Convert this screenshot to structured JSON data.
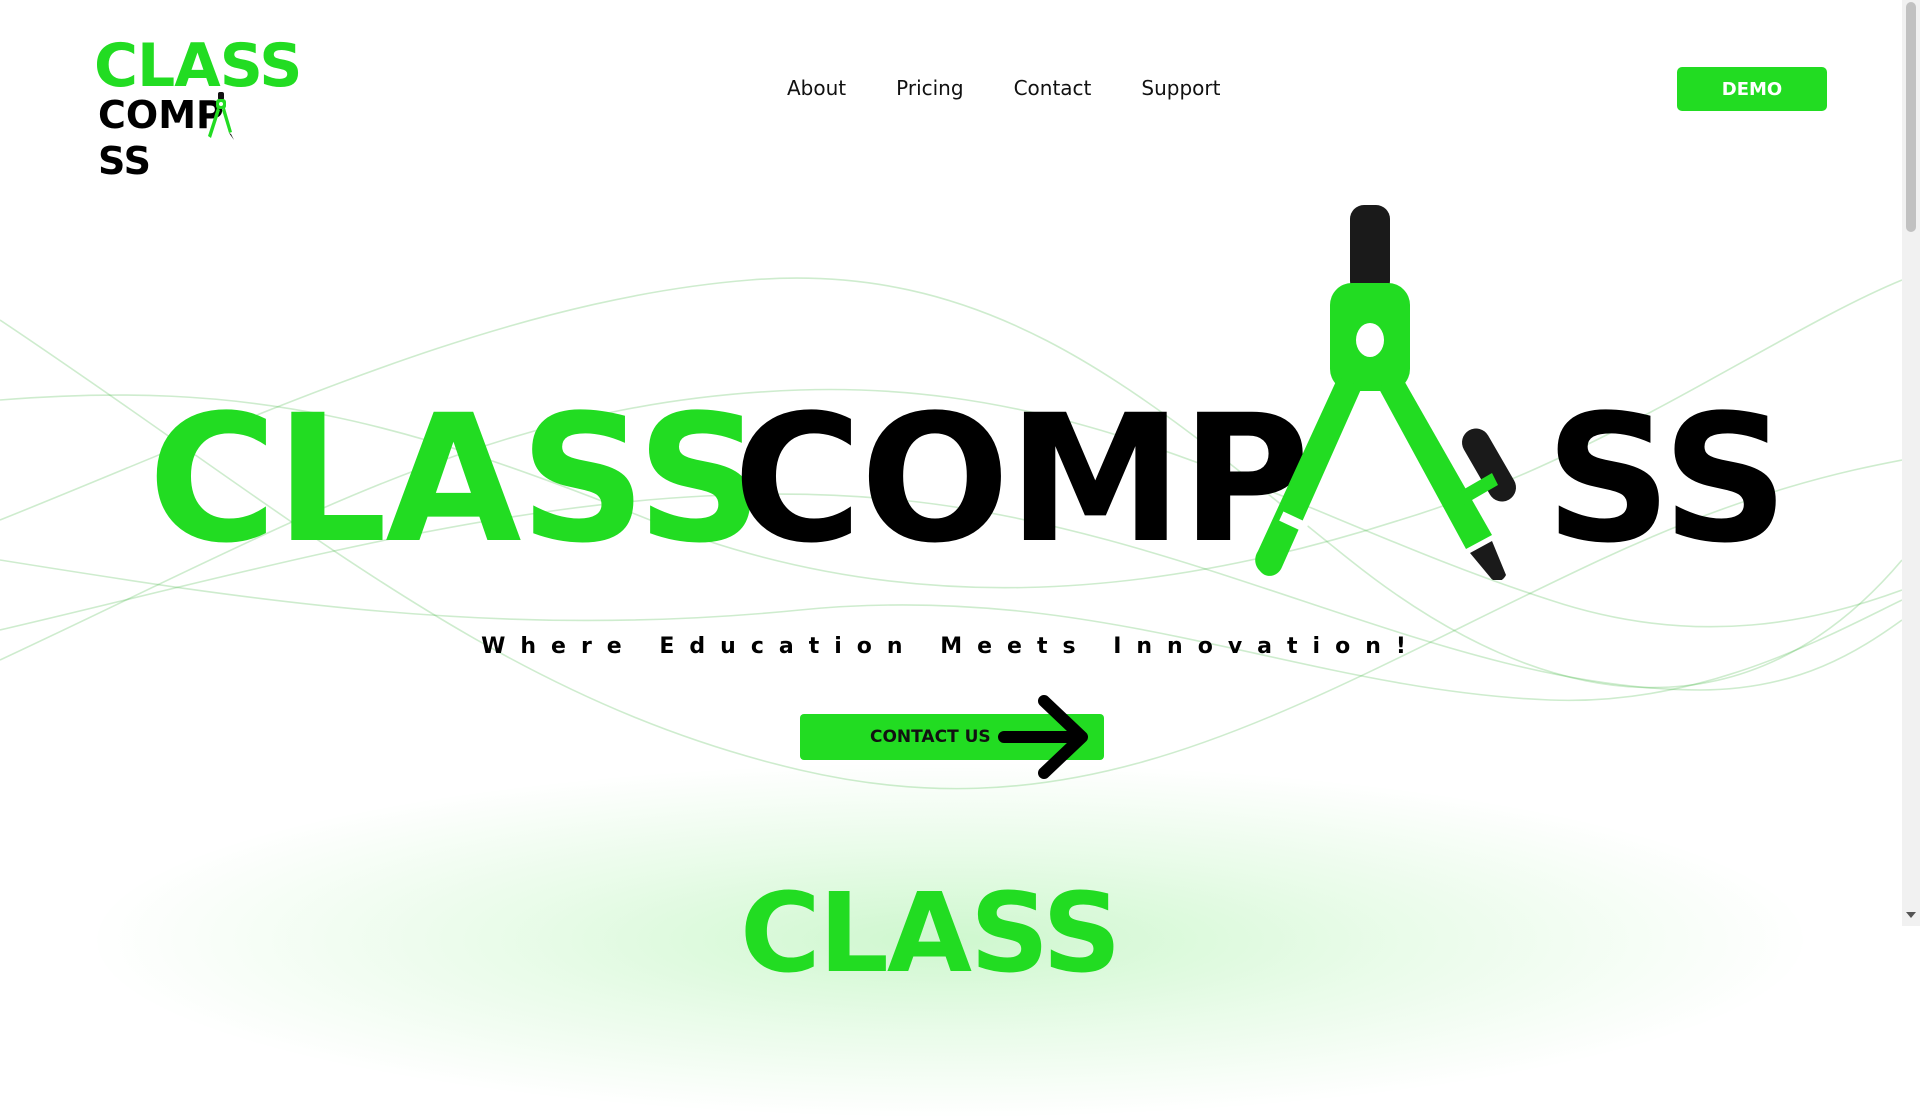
{
  "brand": {
    "logo_line1": "CLASS",
    "logo_line2_left": "COMP",
    "logo_line2_right": "SS",
    "primary_color": "#22dc22",
    "text_color": "#000000"
  },
  "nav": {
    "items": [
      {
        "label": "About"
      },
      {
        "label": "Pricing"
      },
      {
        "label": "Contact"
      },
      {
        "label": "Support"
      }
    ],
    "demo_label": "DEMO"
  },
  "hero": {
    "word1": "CLASS",
    "word2_left": "COMP",
    "word2_right": "SS",
    "tagline": "Where Education Meets Innovation!",
    "cta_label": "CONTACT US",
    "cta_icon": "arrow-right-icon",
    "compass_icon": "drawing-compass-icon"
  },
  "next_section": {
    "title_partial": "CLASS"
  }
}
